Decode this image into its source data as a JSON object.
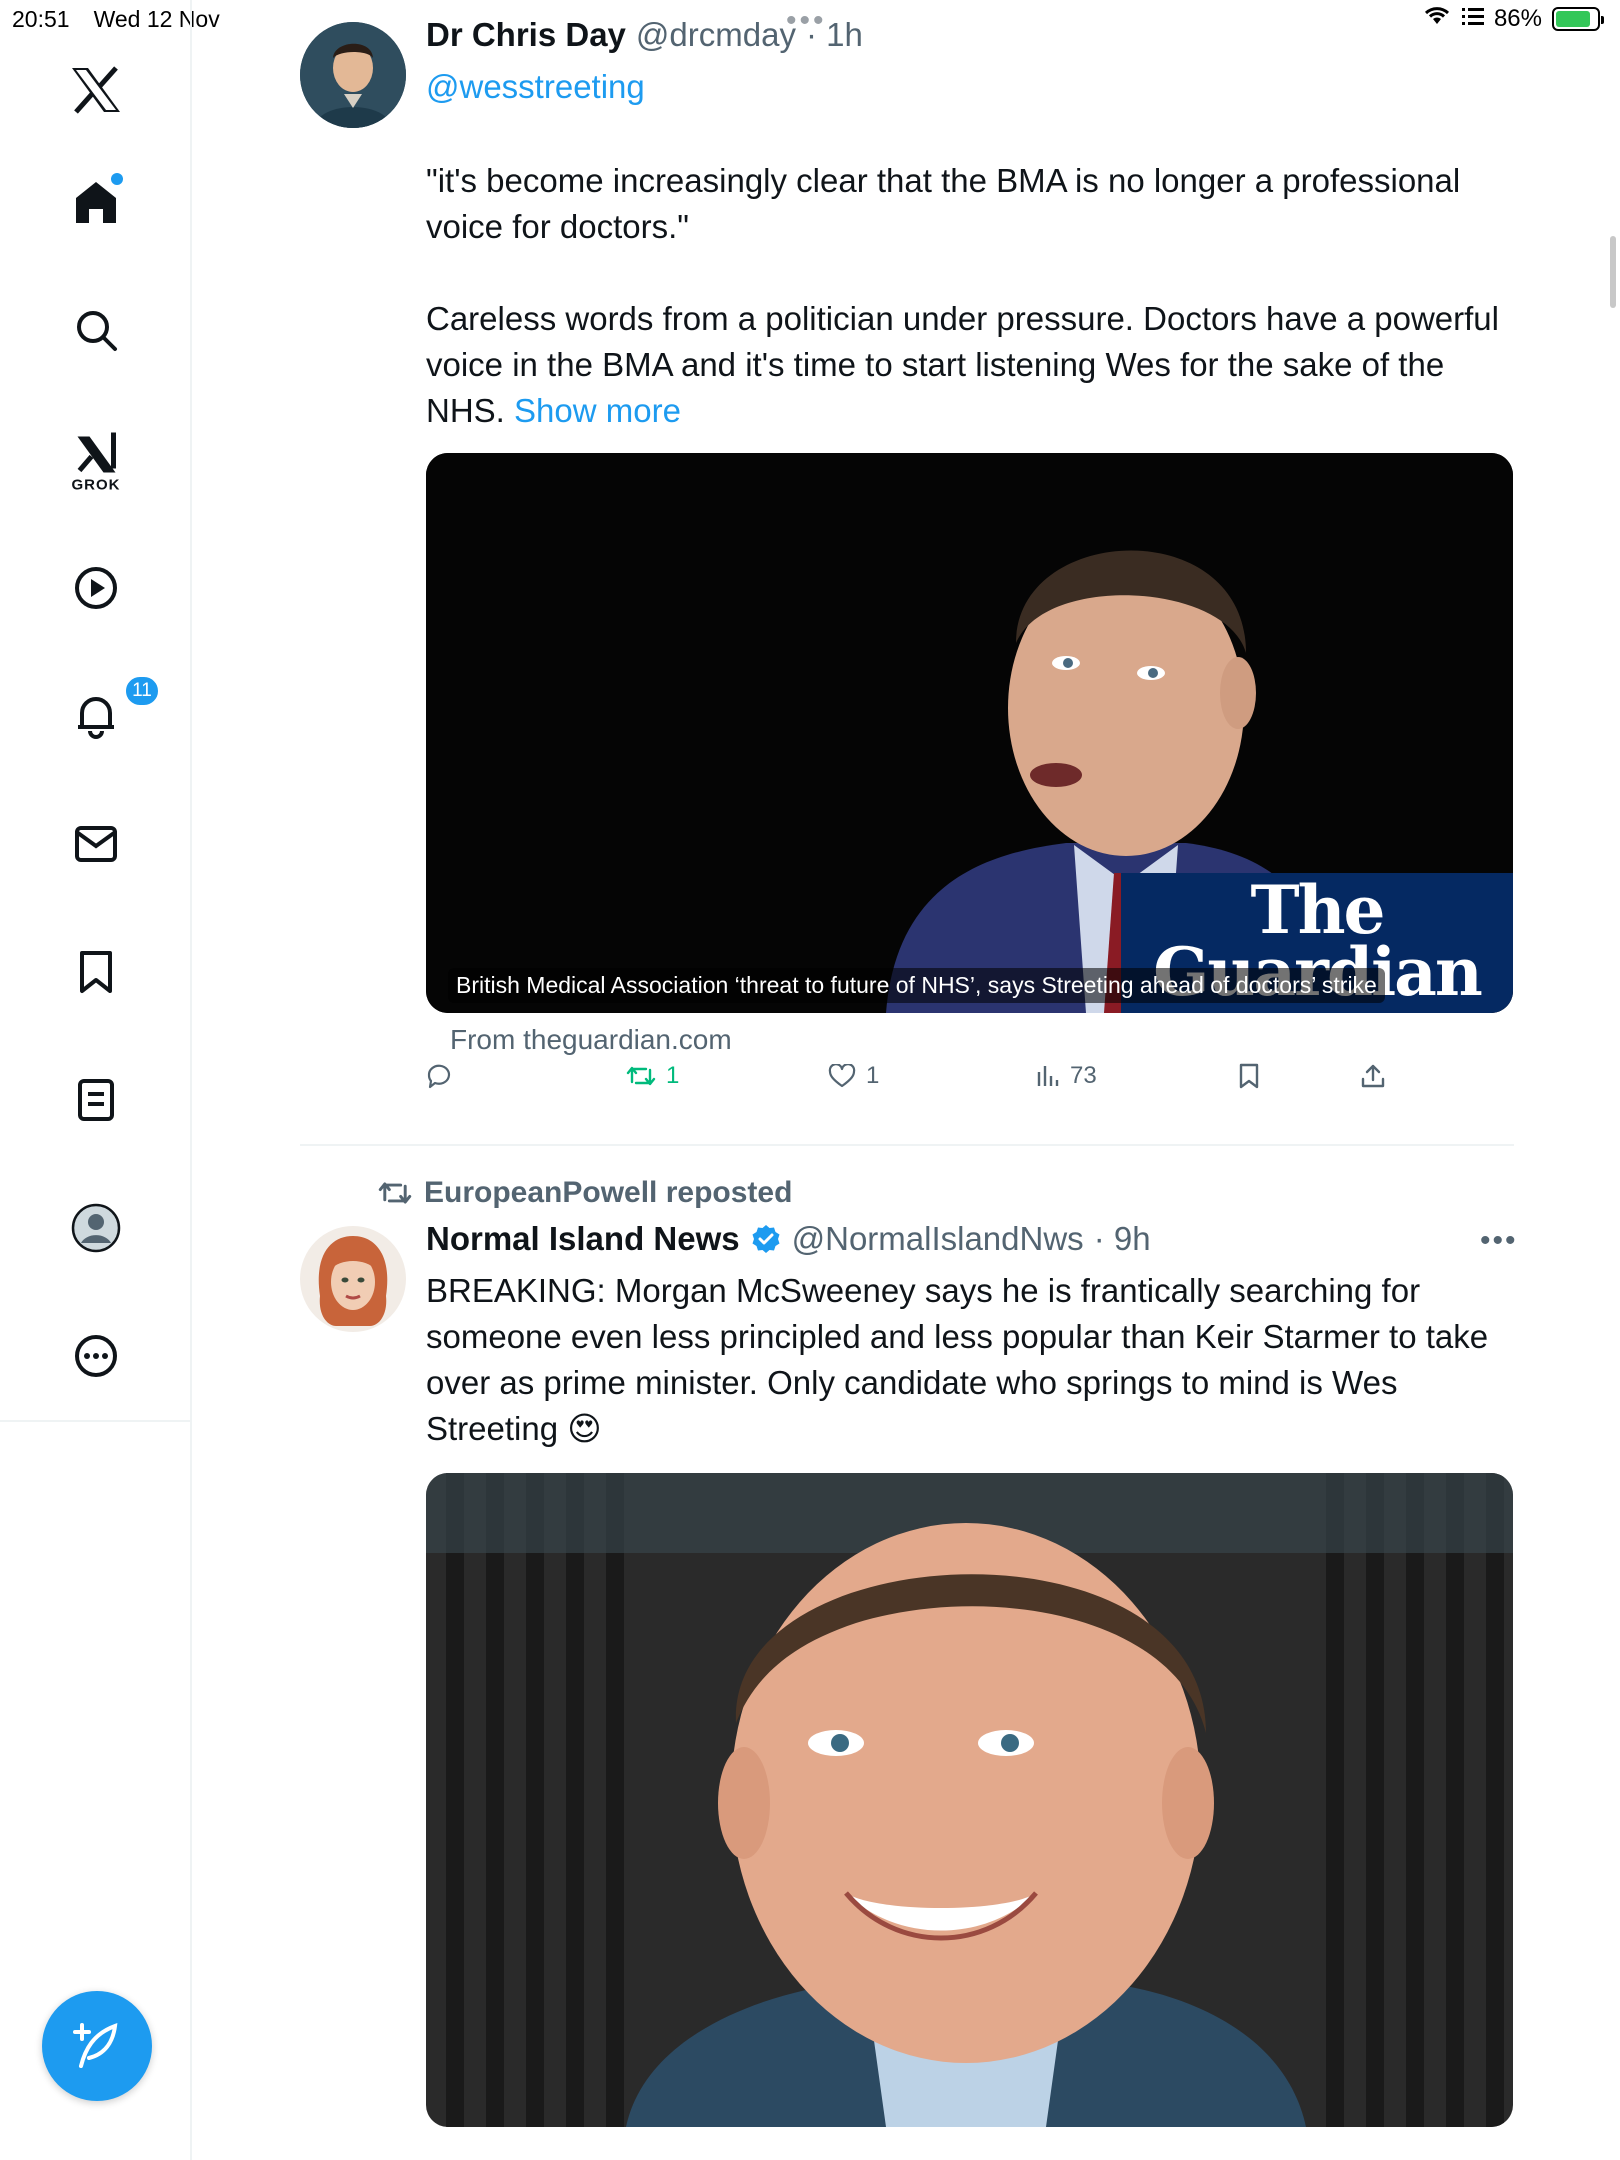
{
  "status_bar": {
    "time": "20:51",
    "date": "Wed 12 Nov",
    "battery": "86%"
  },
  "sidebar": {
    "grok_label": "GROK",
    "notifications_badge": "11",
    "icons": [
      "x-logo-icon",
      "home-icon",
      "search-icon",
      "grok-icon",
      "video-icon",
      "bell-icon",
      "mail-icon",
      "bookmark-icon",
      "lists-icon",
      "profile-icon",
      "more-icon",
      "compose-icon"
    ]
  },
  "tweet1": {
    "name": "Dr Chris Day",
    "handle": "@drcmday",
    "time": "· 1h",
    "reply_to": "@wesstreeting",
    "text_p1": "\"it's become increasingly clear that the BMA is no longer a professional voice for doctors.\"",
    "text_p2": "Careless words from a politician under pressure. Doctors have a powerful voice in the BMA and it's time to start listening Wes for the sake of the NHS.",
    "show_more": "Show more",
    "card": {
      "logo_line1": "The",
      "logo_line2": "Guardian",
      "caption": "British Medical Association ‘threat to future of NHS’, says Streeting ahead of doctors’ strike",
      "from": "From theguardian.com"
    },
    "stats": {
      "replies": "",
      "reposts": "1",
      "likes": "1",
      "views": "73"
    }
  },
  "tweet2": {
    "repost_by": "EuropeanPowell reposted",
    "name": "Normal Island News",
    "handle": "@NormalIslandNws",
    "time": "· 9h",
    "text": "BREAKING: Morgan McSweeney says he is frantically searching for someone even less principled and less popular than Keir Starmer to take over as prime minister. Only candidate who springs to mind is Wes Streeting 😍"
  },
  "colors": {
    "accent": "#1d9bf0",
    "repost_green": "#00ba7c",
    "muted": "#536471",
    "guardian_blue": "#052962"
  }
}
